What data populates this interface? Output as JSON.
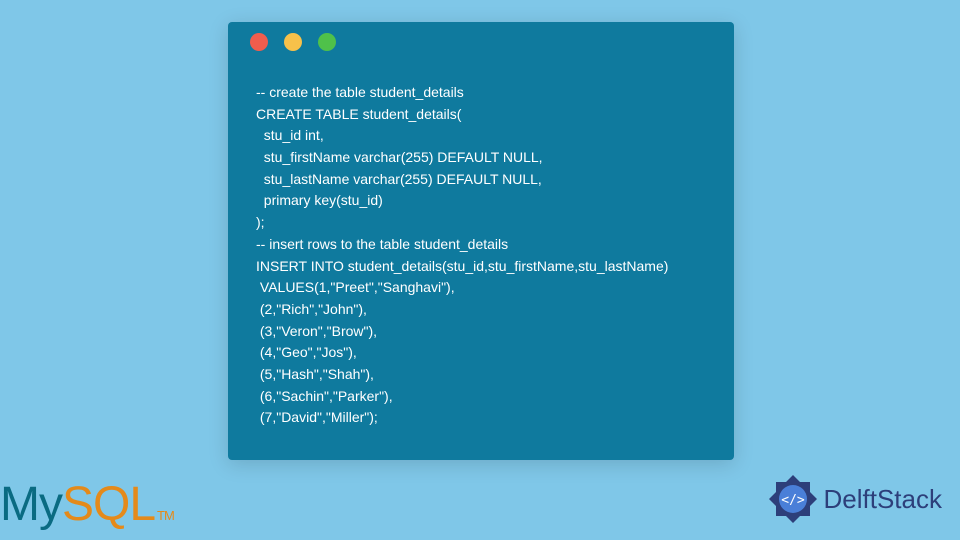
{
  "code": {
    "line1": "-- create the table student_details",
    "line2": "CREATE TABLE student_details(",
    "line3": "  stu_id int,",
    "line4": "  stu_firstName varchar(255) DEFAULT NULL,",
    "line5": "  stu_lastName varchar(255) DEFAULT NULL,",
    "line6": "  primary key(stu_id)",
    "line7": ");",
    "line8": "-- insert rows to the table student_details",
    "line9": "INSERT INTO student_details(stu_id,stu_firstName,stu_lastName)",
    "line10": " VALUES(1,\"Preet\",\"Sanghavi\"),",
    "line11": " (2,\"Rich\",\"John\"),",
    "line12": " (3,\"Veron\",\"Brow\"),",
    "line13": " (4,\"Geo\",\"Jos\"),",
    "line14": " (5,\"Hash\",\"Shah\"),",
    "line15": " (6,\"Sachin\",\"Parker\"),",
    "line16": " (7,\"David\",\"Miller\");"
  },
  "logos": {
    "mysql_my": "My",
    "mysql_sql": "SQL",
    "mysql_tm": "TM",
    "delft": "DelftStack"
  }
}
